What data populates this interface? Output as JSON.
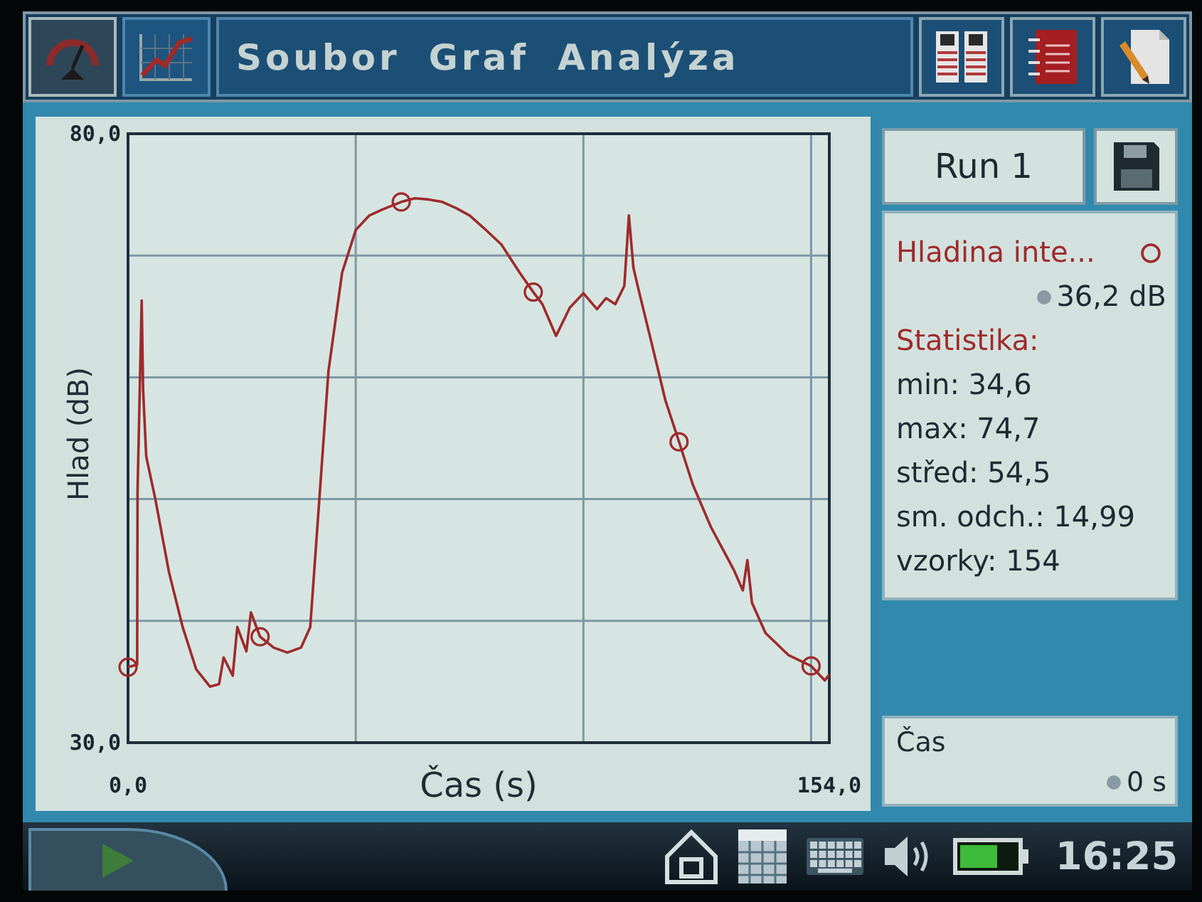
{
  "menubar": {
    "view_tabs": [
      {
        "selected": false
      },
      {
        "selected": true
      }
    ],
    "menus": [
      "Soubor",
      "Graf",
      "Analýza"
    ]
  },
  "graph": {
    "chart_data": {
      "type": "line",
      "xlabel": "Čas (s)",
      "ylabel": "Hlad (dB)",
      "x": [
        0,
        2,
        2.1,
        3,
        3.3,
        4,
        6,
        9,
        12,
        15,
        18,
        20,
        21,
        23,
        24,
        26,
        27,
        29,
        32,
        35,
        38,
        40,
        42,
        44,
        47,
        50,
        53,
        56,
        60,
        63,
        66,
        69,
        72,
        75,
        78,
        82,
        86,
        89,
        91,
        94,
        97,
        100,
        103,
        105,
        107,
        109,
        110,
        111,
        112,
        115,
        118,
        121,
        124,
        128,
        133,
        135,
        136,
        137,
        140,
        145,
        150,
        153,
        154
      ],
      "series": [
        {
          "name": "Hladina inte...",
          "color": "#9e2a2b",
          "values": [
            36.2,
            36.4,
            50.6,
            66.3,
            59.0,
            53.5,
            50.0,
            44.0,
            39.5,
            36.0,
            34.6,
            34.8,
            37.0,
            35.5,
            39.5,
            37.5,
            40.7,
            38.7,
            37.8,
            37.4,
            37.8,
            39.5,
            50.0,
            60.5,
            68.6,
            72.1,
            73.3,
            73.8,
            74.4,
            74.7,
            74.6,
            74.4,
            73.9,
            73.3,
            72.3,
            70.9,
            68.6,
            67.0,
            66.0,
            63.4,
            65.7,
            66.9,
            65.6,
            66.5,
            66.0,
            67.5,
            73.3,
            69.0,
            67.4,
            62.8,
            58.1,
            54.7,
            51.2,
            47.7,
            44.2,
            42.5,
            45.0,
            41.5,
            39.0,
            37.2,
            36.3,
            35.1,
            35.6
          ]
        }
      ],
      "xlim": [
        0,
        154
      ],
      "ylim": [
        30,
        80
      ],
      "xticks": [
        {
          "value": 0,
          "label": "0,0"
        },
        {
          "value": 154,
          "label": "154,0"
        }
      ],
      "yticks": [
        {
          "value": 30,
          "label": "30,0"
        },
        {
          "value": 80,
          "label": "80,0"
        }
      ]
    }
  },
  "run_button": "Run 1",
  "sensor": {
    "reading": "36,2 dB"
  },
  "statistics": {
    "title": "Statistika:",
    "lines": [
      "min: 34,6",
      "max: 74,7",
      "střed: 54,5",
      "sm. odch.: 14,99",
      "vzorky: 154"
    ]
  },
  "cursor": {
    "label": "Čas",
    "reading": "0 s"
  },
  "taskbar": {
    "clock": "16:25"
  }
}
